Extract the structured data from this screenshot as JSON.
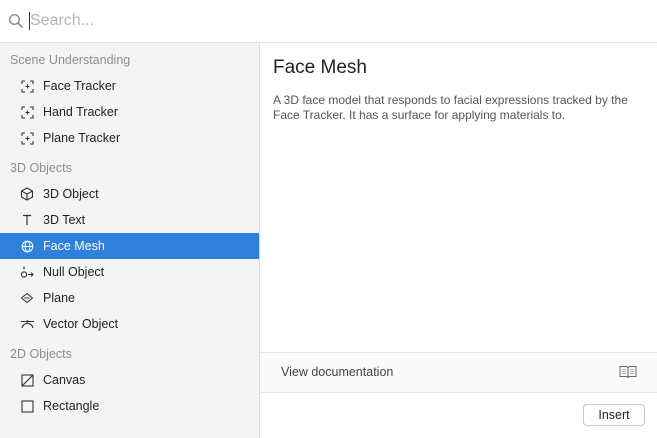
{
  "search": {
    "placeholder": "Search...",
    "value": ""
  },
  "sidebar": {
    "sections": [
      {
        "header": "Scene Understanding",
        "items": [
          {
            "label": "Face Tracker",
            "icon": "tracker-icon"
          },
          {
            "label": "Hand Tracker",
            "icon": "tracker-icon"
          },
          {
            "label": "Plane Tracker",
            "icon": "tracker-icon"
          }
        ]
      },
      {
        "header": "3D Objects",
        "items": [
          {
            "label": "3D Object",
            "icon": "cube-icon"
          },
          {
            "label": "3D Text",
            "icon": "text-icon"
          },
          {
            "label": "Face Mesh",
            "icon": "globe-icon",
            "selected": true
          },
          {
            "label": "Null Object",
            "icon": "null-object-icon"
          },
          {
            "label": "Plane",
            "icon": "plane-icon"
          },
          {
            "label": "Vector Object",
            "icon": "vector-icon"
          }
        ]
      },
      {
        "header": "2D Objects",
        "items": [
          {
            "label": "Canvas",
            "icon": "canvas-icon"
          },
          {
            "label": "Rectangle",
            "icon": "rectangle-icon"
          }
        ]
      }
    ]
  },
  "detail": {
    "title": "Face Mesh",
    "description": "A 3D face model that responds to facial expressions tracked by the Face Tracker. It has a surface for applying materials to.",
    "doc_link": "View documentation",
    "insert_label": "Insert"
  },
  "colors": {
    "selection": "#2f80dd",
    "sidebar_bg": "#f4f4f5"
  }
}
